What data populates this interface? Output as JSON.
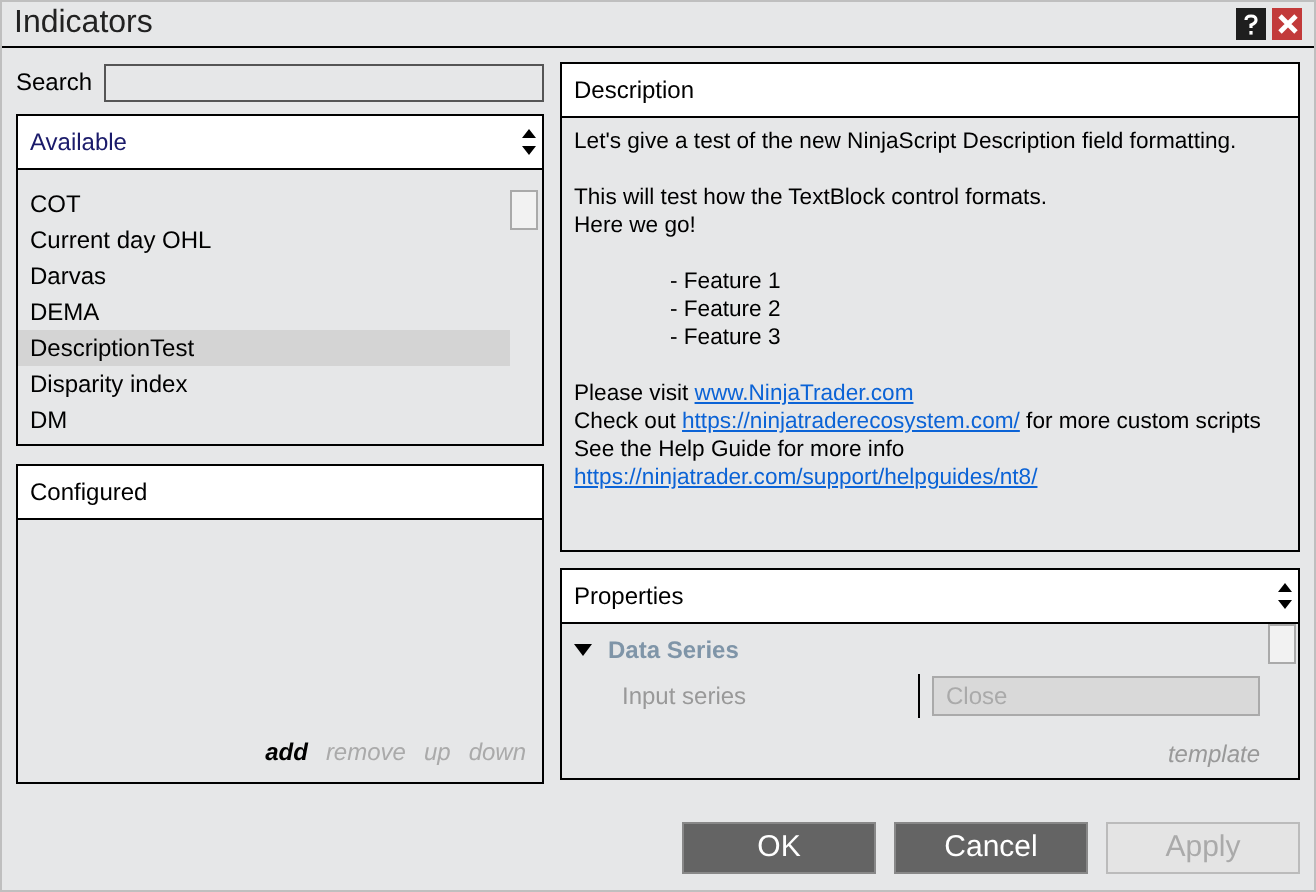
{
  "window": {
    "title": "Indicators"
  },
  "search": {
    "label": "Search"
  },
  "available": {
    "title": "Available",
    "items": [
      {
        "label": "COT",
        "selected": false
      },
      {
        "label": "Current day OHL",
        "selected": false
      },
      {
        "label": "Darvas",
        "selected": false
      },
      {
        "label": "DEMA",
        "selected": false
      },
      {
        "label": "DescriptionTest",
        "selected": true
      },
      {
        "label": "Disparity index",
        "selected": false
      },
      {
        "label": "DM",
        "selected": false
      }
    ]
  },
  "configured": {
    "title": "Configured",
    "actions": [
      {
        "label": "add",
        "disabled": false
      },
      {
        "label": "remove",
        "disabled": true
      },
      {
        "label": "up",
        "disabled": true
      },
      {
        "label": "down",
        "disabled": true
      }
    ]
  },
  "description": {
    "title": "Description",
    "lines": [
      {
        "gap_before": false,
        "indent": false,
        "parts": [
          {
            "kind": "text",
            "text": "Let's give a test of the new NinjaScript Description field formatting."
          }
        ]
      },
      {
        "gap_before": true,
        "indent": false,
        "parts": [
          {
            "kind": "text",
            "text": "This will test how the TextBlock control formats."
          }
        ]
      },
      {
        "gap_before": false,
        "indent": false,
        "parts": [
          {
            "kind": "text",
            "text": "Here we go!"
          }
        ]
      },
      {
        "gap_before": true,
        "indent": true,
        "parts": [
          {
            "kind": "text",
            "text": "- Feature 1"
          }
        ]
      },
      {
        "gap_before": false,
        "indent": true,
        "parts": [
          {
            "kind": "text",
            "text": "- Feature 2"
          }
        ]
      },
      {
        "gap_before": false,
        "indent": true,
        "parts": [
          {
            "kind": "text",
            "text": "- Feature 3"
          }
        ]
      },
      {
        "gap_before": true,
        "indent": false,
        "parts": [
          {
            "kind": "text",
            "text": "Please visit "
          },
          {
            "kind": "link",
            "text": "www.NinjaTrader.com"
          }
        ]
      },
      {
        "gap_before": false,
        "indent": false,
        "parts": [
          {
            "kind": "text",
            "text": "Check out "
          },
          {
            "kind": "link",
            "text": "https://ninjatraderecosystem.com/"
          },
          {
            "kind": "text",
            "text": " for more custom scripts"
          }
        ]
      },
      {
        "gap_before": false,
        "indent": false,
        "parts": [
          {
            "kind": "text",
            "text": "See the Help Guide for more info "
          },
          {
            "kind": "link",
            "text": "https://ninjatrader.com/support/helpguides/nt8/"
          }
        ]
      }
    ]
  },
  "properties": {
    "title": "Properties",
    "categories": [
      {
        "label": "Data Series",
        "expanded": true,
        "rows": [
          {
            "label": "Input series",
            "value": "Close",
            "disabled": true
          }
        ]
      }
    ],
    "template": "template"
  },
  "buttons": [
    {
      "label": "OK",
      "disabled": false
    },
    {
      "label": "Cancel",
      "disabled": false
    },
    {
      "label": "Apply",
      "disabled": true
    }
  ]
}
